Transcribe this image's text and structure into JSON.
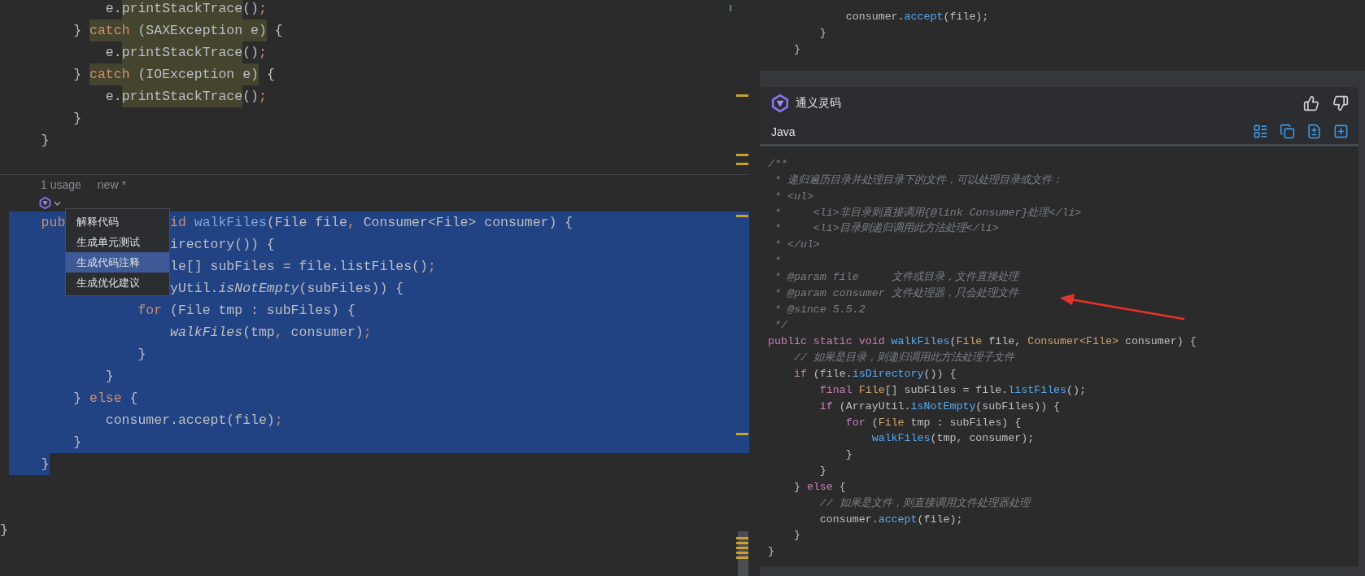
{
  "editor": {
    "top_lines": [
      {
        "tokens": [
          {
            "text": "            e.",
            "kind": "plain"
          },
          {
            "text": "printStackTrace",
            "kind": "mark"
          },
          {
            "text": "()",
            "kind": "plain"
          },
          {
            "text": ";",
            "kind": "punct"
          }
        ]
      },
      {
        "tokens": [
          {
            "text": "        } ",
            "kind": "plain"
          },
          {
            "text": "catch",
            "kind": "markkw"
          },
          {
            "text": " (SAXException e)",
            "kind": "mark"
          },
          {
            "text": " {",
            "kind": "plain"
          }
        ]
      },
      {
        "tokens": [
          {
            "text": "            e.",
            "kind": "plain"
          },
          {
            "text": "printStackTrace",
            "kind": "mark"
          },
          {
            "text": "()",
            "kind": "plain"
          },
          {
            "text": ";",
            "kind": "punct"
          }
        ]
      },
      {
        "tokens": [
          {
            "text": "        } ",
            "kind": "plain"
          },
          {
            "text": "catch",
            "kind": "markkw"
          },
          {
            "text": " (IOException e)",
            "kind": "mark"
          },
          {
            "text": " {",
            "kind": "plain"
          }
        ]
      },
      {
        "tokens": [
          {
            "text": "            e.",
            "kind": "plain"
          },
          {
            "text": "printStackTrace",
            "kind": "mark"
          },
          {
            "text": "()",
            "kind": "plain"
          },
          {
            "text": ";",
            "kind": "punct"
          }
        ]
      },
      {
        "tokens": [
          {
            "text": "        }",
            "kind": "plain"
          }
        ]
      },
      {
        "tokens": [
          {
            "text": "    }",
            "kind": "plain"
          }
        ]
      }
    ],
    "inlay": {
      "usages": "1 usage",
      "status": "new *"
    },
    "popup_menu": {
      "items": [
        {
          "label": "解释代码",
          "selected": false
        },
        {
          "label": "生成单元测试",
          "selected": false
        },
        {
          "label": "生成代码注释",
          "selected": true
        },
        {
          "label": "生成优化建议",
          "selected": false
        }
      ]
    },
    "lines": [
      {
        "selected": true,
        "full_width": true,
        "tokens": [
          {
            "text": "    pub",
            "kind": "keyword"
          }
        ],
        "after_menu": [
          {
            "text": "id",
            "kind": "keyword"
          },
          {
            "text": " walkFiles",
            "kind": "decl"
          },
          {
            "text": "(File file",
            "kind": "plain"
          },
          {
            "text": ",",
            "kind": "punct"
          },
          {
            "text": " Consumer<File> consumer) {",
            "kind": "plain"
          }
        ]
      },
      {
        "selected": true,
        "full_width": true,
        "after_menu": [
          {
            "text": "irectory()) {",
            "kind": "plain"
          }
        ]
      },
      {
        "selected": true,
        "full_width": true,
        "after_menu": [
          {
            "text": "le[] subFiles = file.listFiles()",
            "kind": "plain"
          },
          {
            "text": ";",
            "kind": "punct"
          }
        ]
      },
      {
        "selected": true,
        "full_width": true,
        "after_menu": [
          {
            "text": "yUtil.",
            "kind": "plain"
          },
          {
            "text": "isNotEmpty",
            "kind": "italic"
          },
          {
            "text": "(subFiles)) {",
            "kind": "plain"
          }
        ]
      },
      {
        "selected": true,
        "full_width": true,
        "tokens": [
          {
            "text": "                for",
            "kind": "keyword"
          },
          {
            "text": " (File tmp : subFiles) {",
            "kind": "plain"
          }
        ]
      },
      {
        "selected": true,
        "full_width": true,
        "tokens": [
          {
            "text": "                    walkFiles",
            "kind": "italic"
          },
          {
            "text": "(tmp",
            "kind": "plain"
          },
          {
            "text": ",",
            "kind": "punct"
          },
          {
            "text": " consumer)",
            "kind": "plain"
          },
          {
            "text": ";",
            "kind": "punct"
          }
        ]
      },
      {
        "selected": true,
        "full_width": true,
        "tokens": [
          {
            "text": "                }",
            "kind": "plain"
          }
        ]
      },
      {
        "selected": true,
        "full_width": true,
        "tokens": [
          {
            "text": "            }",
            "kind": "plain"
          }
        ]
      },
      {
        "selected": true,
        "full_width": true,
        "tokens": [
          {
            "text": "        } ",
            "kind": "plain"
          },
          {
            "text": "else",
            "kind": "keyword"
          },
          {
            "text": " {",
            "kind": "plain"
          }
        ]
      },
      {
        "selected": true,
        "full_width": true,
        "tokens": [
          {
            "text": "            consumer.accept(file)",
            "kind": "plain"
          },
          {
            "text": ";",
            "kind": "punct"
          }
        ]
      },
      {
        "selected": true,
        "full_width": true,
        "tokens": [
          {
            "text": "        }",
            "kind": "plain"
          }
        ]
      },
      {
        "selected": true,
        "full_width": false,
        "tokens": [
          {
            "text": "    }",
            "kind": "plain"
          }
        ]
      }
    ],
    "closing_lines": [
      {
        "tokens": [
          {
            "text": "}",
            "kind": "plain"
          }
        ]
      }
    ]
  },
  "assistant": {
    "previous_code": [
      {
        "tokens": [
          {
            "text": "            consumer.",
            "kind": "plain"
          },
          {
            "text": "accept",
            "kind": "fn"
          },
          {
            "text": "(file);",
            "kind": "plain"
          }
        ]
      },
      {
        "tokens": [
          {
            "text": "        }",
            "kind": "plain"
          }
        ]
      },
      {
        "tokens": [
          {
            "text": "    }",
            "kind": "plain"
          }
        ]
      }
    ],
    "title": "通义灵码",
    "language": "Java",
    "code": [
      {
        "tokens": [
          {
            "text": "/**",
            "kind": "doc"
          }
        ]
      },
      {
        "tokens": [
          {
            "text": " * 递归遍历目录并处理目录下的文件，可以处理目录或文件：",
            "kind": "doc"
          }
        ]
      },
      {
        "tokens": [
          {
            "text": " * <ul>",
            "kind": "doc"
          }
        ]
      },
      {
        "tokens": [
          {
            "text": " *     <li>非目录则直接调用{@link Consumer}处理</li>",
            "kind": "doc"
          }
        ]
      },
      {
        "tokens": [
          {
            "text": " *     <li>目录则递归调用此方法处理</li>",
            "kind": "doc"
          }
        ]
      },
      {
        "tokens": [
          {
            "text": " * </ul>",
            "kind": "doc"
          }
        ]
      },
      {
        "tokens": [
          {
            "text": " *",
            "kind": "doc"
          }
        ]
      },
      {
        "tokens": [
          {
            "text": " * @param file     文件或目录，文件直接处理",
            "kind": "doc"
          }
        ]
      },
      {
        "tokens": [
          {
            "text": " * @param consumer 文件处理器，只会处理文件",
            "kind": "doc"
          }
        ]
      },
      {
        "tokens": [
          {
            "text": " * @since 5.5.2",
            "kind": "doc"
          }
        ]
      },
      {
        "tokens": [
          {
            "text": " */",
            "kind": "doc"
          }
        ]
      },
      {
        "tokens": [
          {
            "text": "public static void ",
            "kind": "reserved"
          },
          {
            "text": "walkFiles",
            "kind": "fn"
          },
          {
            "text": "(",
            "kind": "plain"
          },
          {
            "text": "File",
            "kind": "type"
          },
          {
            "text": " file, ",
            "kind": "plain"
          },
          {
            "text": "Consumer<File>",
            "kind": "type"
          },
          {
            "text": " consumer) {",
            "kind": "plain"
          }
        ]
      },
      {
        "tokens": [
          {
            "text": "    // 如果是目录，则递归调用此方法处理子文件",
            "kind": "comment"
          }
        ]
      },
      {
        "tokens": [
          {
            "text": "    if",
            "kind": "reserved"
          },
          {
            "text": " (file.",
            "kind": "plain"
          },
          {
            "text": "isDirectory",
            "kind": "fn"
          },
          {
            "text": "()) {",
            "kind": "plain"
          }
        ]
      },
      {
        "tokens": [
          {
            "text": "        final ",
            "kind": "reserved"
          },
          {
            "text": "File",
            "kind": "type"
          },
          {
            "text": "[] subFiles = file.",
            "kind": "plain"
          },
          {
            "text": "listFiles",
            "kind": "fn"
          },
          {
            "text": "();",
            "kind": "plain"
          }
        ]
      },
      {
        "tokens": [
          {
            "text": "        if",
            "kind": "reserved"
          },
          {
            "text": " (ArrayUtil.",
            "kind": "plain"
          },
          {
            "text": "isNotEmpty",
            "kind": "fn"
          },
          {
            "text": "(subFiles)) {",
            "kind": "plain"
          }
        ]
      },
      {
        "tokens": [
          {
            "text": "            for",
            "kind": "reserved"
          },
          {
            "text": " (",
            "kind": "plain"
          },
          {
            "text": "File",
            "kind": "type"
          },
          {
            "text": " tmp : subFiles) {",
            "kind": "plain"
          }
        ]
      },
      {
        "tokens": [
          {
            "text": "                walkFiles",
            "kind": "fn"
          },
          {
            "text": "(tmp, consumer);",
            "kind": "plain"
          }
        ]
      },
      {
        "tokens": [
          {
            "text": "            }",
            "kind": "plain"
          }
        ]
      },
      {
        "tokens": [
          {
            "text": "        }",
            "kind": "plain"
          }
        ]
      },
      {
        "tokens": [
          {
            "text": "    } ",
            "kind": "plain"
          },
          {
            "text": "else",
            "kind": "reserved"
          },
          {
            "text": " {",
            "kind": "plain"
          }
        ]
      },
      {
        "tokens": [
          {
            "text": "        // 如果是文件，则直接调用文件处理器处理",
            "kind": "comment"
          }
        ]
      },
      {
        "tokens": [
          {
            "text": "        consumer.",
            "kind": "plain"
          },
          {
            "text": "accept",
            "kind": "fn"
          },
          {
            "text": "(file);",
            "kind": "plain"
          }
        ]
      },
      {
        "tokens": [
          {
            "text": "    }",
            "kind": "plain"
          }
        ]
      },
      {
        "tokens": [
          {
            "text": "}",
            "kind": "plain"
          }
        ]
      }
    ]
  }
}
